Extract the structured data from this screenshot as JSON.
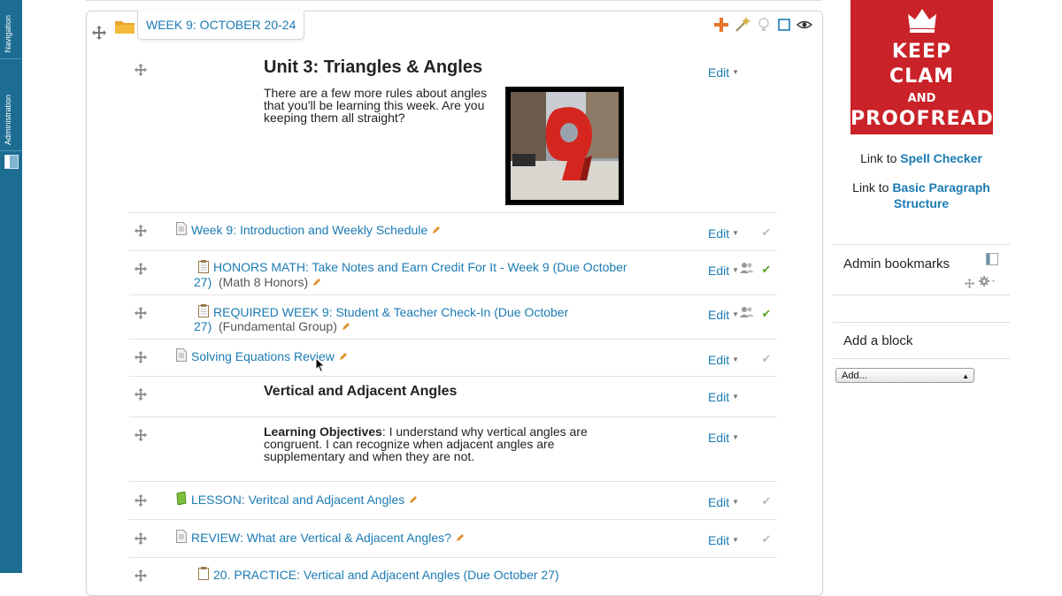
{
  "dock": {
    "navigation_label": "Navigation",
    "administration_label": "Administration"
  },
  "section": {
    "week_title": "WEEK 9: OCTOBER 20-24",
    "unit_title": "Unit 3: Triangles & Angles",
    "unit_intro": "There are a few more rules about angles that you'll be learning this week. Are you keeping them all straight?",
    "edit_label": "Edit",
    "activities": [
      {
        "title": "Week 9: Introduction and Weekly Schedule",
        "suffix": ""
      },
      {
        "title_line1": "HONORS MATH: Take Notes and Earn Credit For It - Week 9 (Due October",
        "title_line2": "27)",
        "suffix": "(Math 8 Honors)"
      },
      {
        "title_line1": "REQUIRED WEEK 9: Student & Teacher Check-In (Due October",
        "title_line2": "27)",
        "suffix": "(Fundamental Group)"
      },
      {
        "title": "Solving Equations Review",
        "suffix": ""
      },
      {
        "title": "LESSON: Veritcal and Adjacent Angles",
        "suffix": ""
      },
      {
        "title": "REVIEW: What are Vertical & Adjacent Angles?",
        "suffix": ""
      },
      {
        "title": "20. PRACTICE: Vertical and Adjacent Angles (Due October 27)",
        "suffix": ""
      }
    ],
    "vertical_heading": "Vertical and Adjacent Angles",
    "objectives_label": "Learning Objectives",
    "objectives_text": ": I understand why vertical angles are congruent. I can recognize when adjacent angles are supplementary and when they are not."
  },
  "sidebar": {
    "poster": {
      "line1": "KEEP",
      "line2": "CLAM",
      "line3": "AND",
      "line4": "PROOFREAD"
    },
    "spell_prefix": "Link to",
    "spell_link": "Spell Checker",
    "para_prefix": "Link to",
    "para_link": "Basic Paragraph Structure",
    "admin_bookmarks_title": "Admin bookmarks",
    "add_block_title": "Add a block",
    "add_block_select": "Add..."
  },
  "colors": {
    "link": "#1b7bb3",
    "dock": "#1d6d93",
    "poster": "#c92228",
    "complete_green": "#5aa52a"
  }
}
